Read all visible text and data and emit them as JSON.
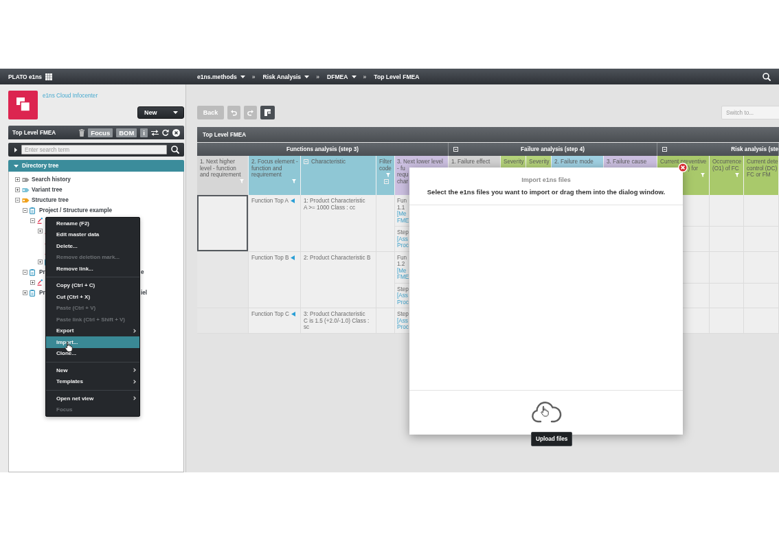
{
  "top_bar": {
    "app_name": "PLATO e1ns",
    "breadcrumb": [
      {
        "label": "e1ns.methods",
        "dropdown": true
      },
      {
        "separator": "»",
        "label": "Risk Analysis",
        "dropdown": true
      },
      {
        "separator": "»",
        "label": "DFMEA",
        "dropdown": true
      },
      {
        "separator": "»",
        "label": "Top Level FMEA",
        "dropdown": false
      }
    ]
  },
  "sidebar": {
    "infocenter_link": "e1ns Cloud Infocenter",
    "new_button": "New",
    "object_panel": {
      "title": "Top Level FMEA",
      "badges": [
        "Focus",
        "BOM",
        "i"
      ]
    },
    "search": {
      "placeholder": "Enter search term",
      "options_expanded": false
    },
    "directory_tree": {
      "title": "Directory tree",
      "expanded": true,
      "items": [
        {
          "kind": "history",
          "label": "Search history",
          "expanded": false
        },
        {
          "kind": "variant",
          "label": "Variant tree",
          "expanded": false
        },
        {
          "kind": "structure",
          "label": "Structure tree",
          "expanded": true,
          "children": [
            {
              "kind": "project",
              "label": "Project / Structure example",
              "expanded": true,
              "children": [
                {
                  "kind": "fmea",
                  "expanded": true,
                  "children": [
                    {
                      "kind": "fmea",
                      "expanded": false
                    },
                    {
                      "kind": "fmea"
                    },
                    {
                      "kind": "fmea"
                    },
                    {
                      "kind": "project",
                      "expanded": false
                    }
                  ]
                }
              ]
            },
            {
              "kind": "project",
              "label": "Pr",
              "label_tail": "e",
              "expanded": true,
              "children": [
                {
                  "kind": "fmea",
                  "expanded": false
                }
              ]
            },
            {
              "kind": "project",
              "label": "Pr",
              "label_tail": "iel",
              "expanded": false
            }
          ]
        }
      ]
    }
  },
  "context_menu": {
    "groups": [
      [
        {
          "label": "Rename (F2)",
          "disabled": false,
          "selected": false,
          "submenu": false
        },
        {
          "label": "Edit master data",
          "disabled": false,
          "selected": false,
          "submenu": false
        },
        {
          "label": "Delete...",
          "disabled": false,
          "selected": false,
          "submenu": false
        },
        {
          "label": "Remove deletion mark...",
          "disabled": true,
          "selected": false,
          "submenu": false
        },
        {
          "label": "Remove link...",
          "disabled": false,
          "selected": false,
          "submenu": false
        }
      ],
      [
        {
          "label": "Copy (Ctrl + C)",
          "disabled": false,
          "selected": false,
          "submenu": false
        },
        {
          "label": "Cut (Ctrl + X)",
          "disabled": false,
          "selected": false,
          "submenu": false
        },
        {
          "label": "Paste (Ctrl + V)",
          "disabled": true,
          "selected": false,
          "submenu": false
        },
        {
          "label": "Paste link (Ctrl + Shift + V)",
          "disabled": true,
          "selected": false,
          "submenu": false
        },
        {
          "label": "Export",
          "disabled": false,
          "selected": false,
          "submenu": true
        },
        {
          "label": "Import...",
          "disabled": false,
          "selected": true,
          "submenu": false
        },
        {
          "label": "Clone...",
          "disabled": false,
          "selected": false,
          "submenu": false
        }
      ],
      [
        {
          "label": "New",
          "disabled": false,
          "selected": false,
          "submenu": true
        },
        {
          "label": "Templates",
          "disabled": false,
          "selected": false,
          "submenu": true
        }
      ],
      [
        {
          "label": "Open net view",
          "disabled": false,
          "selected": false,
          "submenu": true
        },
        {
          "label": "Focus",
          "disabled": true,
          "selected": false,
          "submenu": false
        }
      ]
    ]
  },
  "toolbar": {
    "buttons": [
      {
        "kind": "back",
        "label": "Back",
        "disabled": true
      },
      {
        "kind": "undo",
        "disabled": true
      },
      {
        "kind": "redo",
        "disabled": true
      },
      {
        "kind": "layout",
        "disabled": false
      }
    ],
    "switch_field": {
      "placeholder": "Switch to..."
    }
  },
  "table": {
    "title": "Top Level FMEA",
    "groups": [
      {
        "label": "Functions analysis (step 3)",
        "collapsible": false,
        "columns": [
          {
            "label": "1. Next higher\nlevel - function\nand requirement",
            "color": "#d6d6d6",
            "filter": true,
            "collapsible": false
          },
          {
            "label": "2. Focus element -\nfunction and\nrequirement",
            "color": "#8fc7d5",
            "filter": true,
            "collapsible": false
          },
          {
            "label": "Characteristic",
            "color": "#8fc7d5",
            "filter": false,
            "collapsible": true
          },
          {
            "label": "Filter\ncode",
            "color": "#8fc7d5",
            "filter": true,
            "collapsible": true
          },
          {
            "label": "3. Next lower level",
            "color": "#cbbfe0",
            "filter": false,
            "collapsible": false,
            "cut_end_lines": [
              "- fu",
              "requ",
              "char"
            ]
          }
        ]
      },
      {
        "label": "Failure analysis (step 4)",
        "collapsible": true,
        "columns": [
          {
            "label": "1. Failure effect",
            "color": "#d2d2d2",
            "filter": false,
            "collapsible": false
          },
          {
            "label": "Severity",
            "color": "#b4d27a",
            "filter": false,
            "collapsible": false
          },
          {
            "label": "Severity",
            "color": "#b4d27a",
            "filter": false,
            "collapsible": false
          },
          {
            "label": "2. Failure mode",
            "color": "#9fd0e2",
            "filter": false,
            "collapsible": false
          },
          {
            "label": "3. Failure cause",
            "color": "#cbbfe0",
            "filter": false,
            "collapsible": false
          }
        ]
      },
      {
        "label": "Risk analysis (ste",
        "collapsible": true,
        "columns": [
          {
            "label": "Current preventive",
            "color": "#a9c96b",
            "filter": true,
            "collapsible": false,
            "cut_start_lines": [
              ") for"
            ]
          },
          {
            "label": "Occurrence\n(O1) of FC",
            "color": "#a9c96b",
            "filter": true,
            "collapsible": false
          },
          {
            "label": "Current dete\ncontrol (DC)\nFC or FM",
            "color": "#a9c96b",
            "filter": false,
            "collapsible": false
          }
        ]
      }
    ],
    "rows": [
      {
        "selected": true,
        "function": "Function Top A",
        "characteristic": "1: Product Characteristic\nA >= 1000 Class : cc",
        "lower_level": [
          {
            "lines": [
              {
                "kind": "text",
                "text": "Fun"
              },
              {
                "kind": "text",
                "text": "1.1"
              },
              {
                "kind": "link",
                "text": "[Me"
              },
              {
                "kind": "link",
                "text": "FME"
              }
            ]
          },
          {
            "lines": [
              {
                "kind": "text",
                "text": "Step"
              },
              {
                "kind": "link",
                "text": "[Ass"
              },
              {
                "kind": "link",
                "text": "Proc"
              }
            ]
          }
        ]
      },
      {
        "selected": false,
        "function": "Function Top B",
        "characteristic": "2: Product Characteristic B",
        "lower_level": [
          {
            "lines": [
              {
                "kind": "text",
                "text": "Fun"
              },
              {
                "kind": "text",
                "text": "1.2"
              },
              {
                "kind": "link",
                "text": "[Me"
              },
              {
                "kind": "link",
                "text": "FME"
              }
            ]
          },
          {
            "lines": [
              {
                "kind": "text",
                "text": "Step"
              },
              {
                "kind": "link",
                "text": "[Ass"
              },
              {
                "kind": "link",
                "text": "Proc"
              }
            ]
          }
        ]
      },
      {
        "selected": false,
        "function": "Function Top C",
        "characteristic": "3: Product Characteristic\nC is 1.5 (+2.0/-1.0) Class :\nsc",
        "lower_level": [
          {
            "lines": [
              {
                "kind": "text",
                "text": "Step"
              },
              {
                "kind": "link",
                "text": "[Ass"
              },
              {
                "kind": "link",
                "text": "Proc"
              }
            ]
          }
        ]
      }
    ]
  },
  "dialog": {
    "title": "Import e1ns files",
    "instruction": "Select the e1ns files you want to import or drag them into the dialog window.",
    "upload_tooltip": "Upload files"
  }
}
